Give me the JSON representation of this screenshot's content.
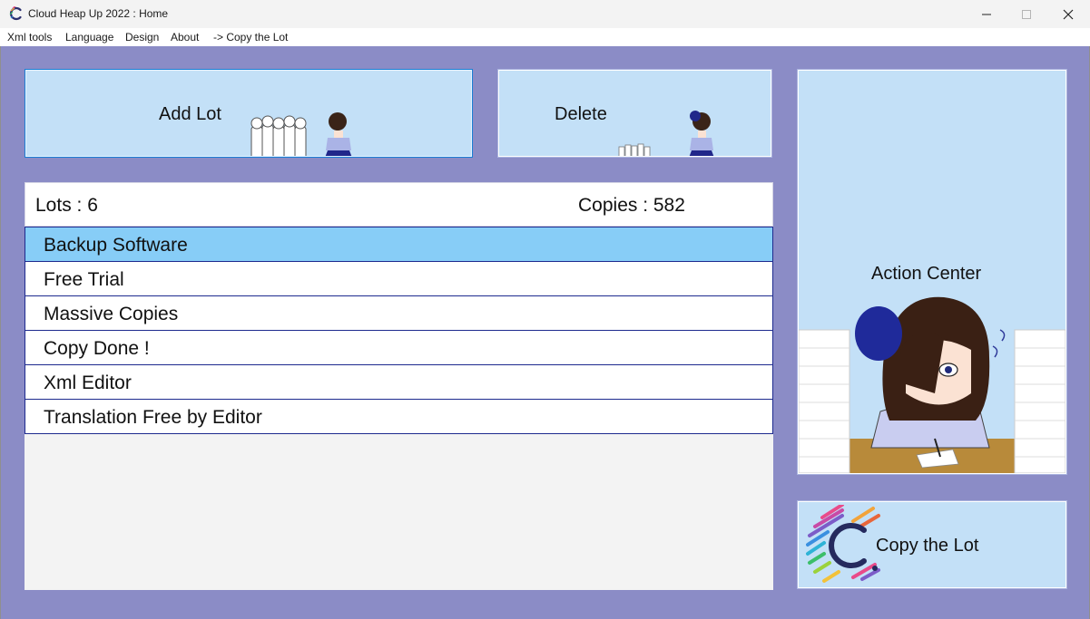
{
  "window": {
    "title": "Cloud Heap Up 2022 : Home"
  },
  "menu": {
    "items": [
      "Xml tools",
      "Language",
      "Design",
      "About",
      "-> Copy the Lot"
    ]
  },
  "buttons": {
    "add_lot": "Add Lot",
    "delete": "Delete",
    "action_center": "Action Center",
    "copy_the_lot": "Copy the Lot"
  },
  "summary": {
    "lots": "Lots : 6",
    "copies": "Copies : 582"
  },
  "lots_list": {
    "selected": "Backup Software",
    "items": [
      "Backup Software",
      "Free Trial",
      "Massive Copies",
      "Copy Done !",
      "Xml Editor",
      "Translation Free by Editor"
    ]
  },
  "colors": {
    "workspace": "#8b8cc6",
    "panel": "#c3e0f7",
    "selected_row": "#87cdf7",
    "row_border": "#1d2a8e"
  }
}
